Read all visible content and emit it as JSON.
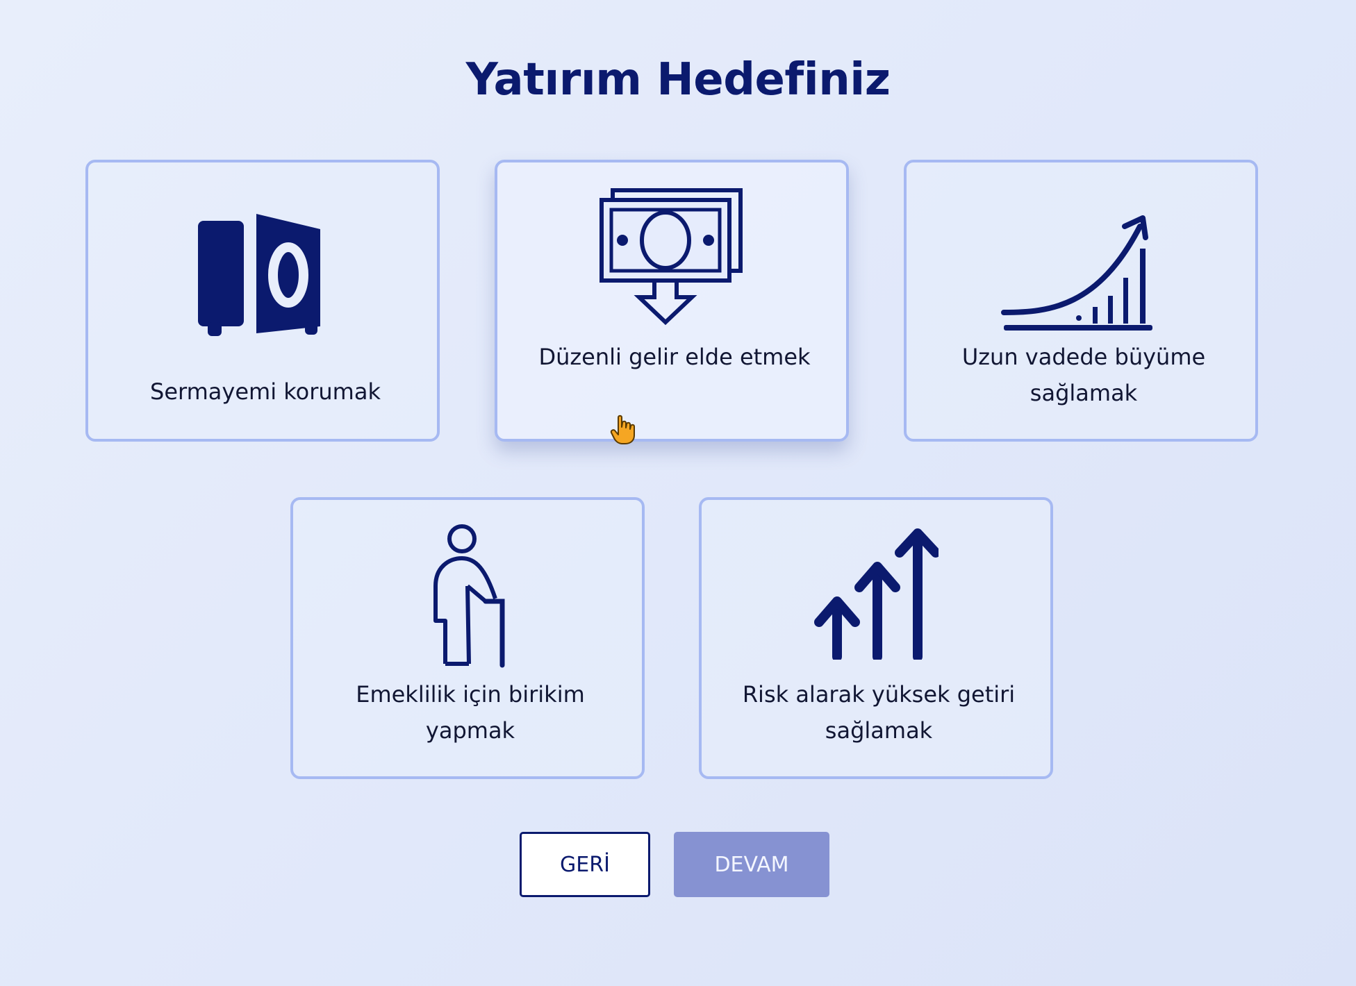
{
  "page": {
    "title": "Yatırım Hedefiniz"
  },
  "options": [
    {
      "id": "protect-capital",
      "label": "Sermayemi korumak",
      "icon": "safe-icon"
    },
    {
      "id": "regular-income",
      "label": "Düzenli gelir elde etmek",
      "icon": "money-down-icon",
      "state": "hovered"
    },
    {
      "id": "long-term-growth",
      "label": "Uzun vadede büyüme sağlamak",
      "icon": "growth-chart-icon"
    },
    {
      "id": "retirement-savings",
      "label": "Emeklilik için birikim yapmak",
      "icon": "elderly-person-icon"
    },
    {
      "id": "high-return",
      "label": "Risk alarak yüksek getiri sağlamak",
      "icon": "arrows-up-icon"
    }
  ],
  "buttons": {
    "back": "GERİ",
    "next": "DEVAM"
  },
  "colors": {
    "primary": "#0b1a6e",
    "card_border": "#a6b9f2",
    "next_button": "#8692d2"
  }
}
